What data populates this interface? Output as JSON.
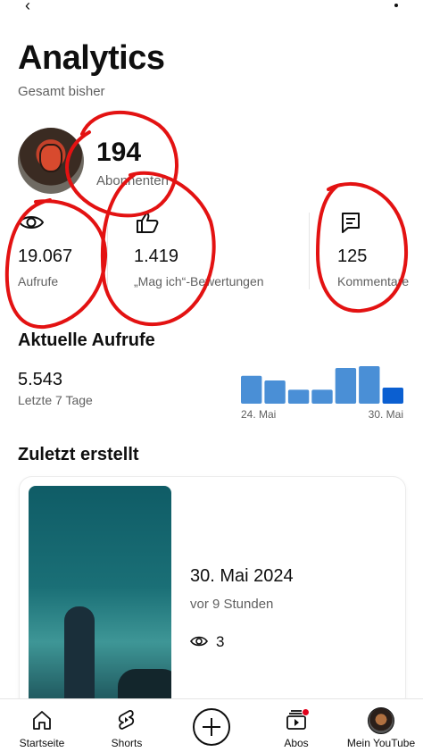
{
  "header": {
    "title": "Analytics",
    "subtitle": "Gesamt bisher"
  },
  "channel": {
    "subscribers_value": "194",
    "subscribers_label": "Abonnenten"
  },
  "stats": [
    {
      "icon": "eye-icon",
      "value": "19.067",
      "label": "Aufrufe"
    },
    {
      "icon": "thumbs-up-icon",
      "value": "1.419",
      "label": "„Mag ich“-Bewertungen"
    },
    {
      "icon": "comment-icon",
      "value": "125",
      "label": "Kommentare"
    }
  ],
  "recent_views": {
    "title": "Aktuelle Aufrufe",
    "value": "5.543",
    "label": "Letzte 7 Tage",
    "chart_data": {
      "type": "bar",
      "categories": [
        "24. Mai",
        "25. Mai",
        "26. Mai",
        "27. Mai",
        "28. Mai",
        "29. Mai",
        "30. Mai"
      ],
      "values": [
        0.78,
        0.65,
        0.39,
        0.39,
        1.0,
        1.05,
        0.45
      ],
      "x_tick_labels": [
        "24. Mai",
        "30. Mai"
      ],
      "bar_color": "#4a8fd6",
      "last_bar_color": "#0b5fd1"
    }
  },
  "latest": {
    "title": "Zuletzt erstellt",
    "video_date": "30. Mai 2024",
    "video_age": "vor 9 Stunden",
    "video_views": "3"
  },
  "nav": [
    {
      "label": "Startseite",
      "icon": "home-icon"
    },
    {
      "label": "Shorts",
      "icon": "shorts-icon"
    },
    {
      "label": "",
      "icon": "create-icon"
    },
    {
      "label": "Abos",
      "icon": "subscriptions-icon"
    },
    {
      "label": "Mein YouTube",
      "icon": "profile-avatar"
    }
  ],
  "colors": {
    "annotation_red": "#e31212",
    "text_secondary": "#606060",
    "notification": "#e0001b"
  }
}
